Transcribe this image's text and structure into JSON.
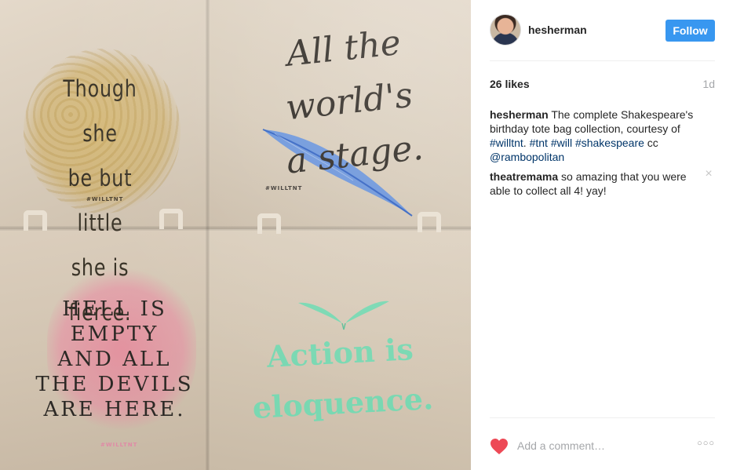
{
  "photo": {
    "bags": [
      {
        "quote": "Though she\nbe but little\nshe is fierce.",
        "tag": "#WILLTNT"
      },
      {
        "quote": "All the\nworld's\na stage.",
        "tag": "#WILLTNT"
      },
      {
        "quote": "HELL IS\nEMPTY\nAND ALL\nTHE DEVILS\nARE HERE.",
        "tag": "#WILLTNT"
      },
      {
        "quote": "Action is\neloquence.",
        "tag": ""
      }
    ]
  },
  "post": {
    "username": "hesherman",
    "follow_label": "Follow",
    "likes": "26 likes",
    "time": "1d",
    "caption": {
      "username": "hesherman",
      "text": "The complete Shakespeare's birthday tote bag collection, courtesy of",
      "hashtags": [
        "#willtnt",
        "#tnt",
        "#will",
        "#shakespeare"
      ],
      "cc": "cc",
      "mention": "@rambopolitan"
    },
    "comments": [
      {
        "username": "theatremama",
        "text": "so amazing that you were able to collect all 4! yay!"
      }
    ],
    "add_comment_placeholder": "Add a comment…",
    "more_label": "○○○",
    "close_label": "×"
  },
  "colors": {
    "follow_button": "#3897f0",
    "link": "#003569",
    "heart": "#ed4956",
    "muted": "#a5a7aa"
  },
  "icons": {
    "like": "heart-icon",
    "remove_comment": "close-icon",
    "more": "more-options-icon"
  }
}
